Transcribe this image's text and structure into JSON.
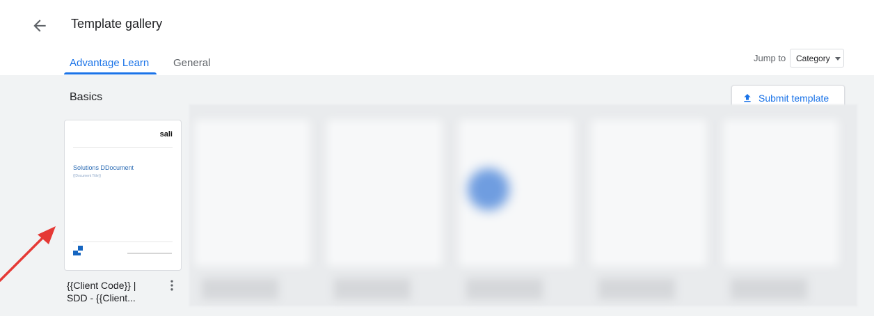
{
  "header": {
    "title": "Template gallery",
    "tabs": [
      {
        "label": "Advantage Learn",
        "active": true
      },
      {
        "label": "General",
        "active": false
      }
    ],
    "jump_to": {
      "label": "Jump to",
      "selected": "Category"
    }
  },
  "gallery": {
    "section_title": "Basics",
    "submit_label": "Submit template",
    "templates": [
      {
        "label": "{{Client Code}} | SDD - {{Client...",
        "preview": {
          "logo_text": "sali",
          "doc_title": "Solutions DDocument",
          "doc_subtitle": "{{Document Title}}"
        }
      }
    ]
  },
  "colors": {
    "accent": "#1a73e8",
    "gallery_bg": "#f1f3f4",
    "annotation_arrow": "#e53935"
  },
  "icons": [
    "back-arrow-icon",
    "chevron-down-icon",
    "upload-icon",
    "more-vert-icon"
  ]
}
